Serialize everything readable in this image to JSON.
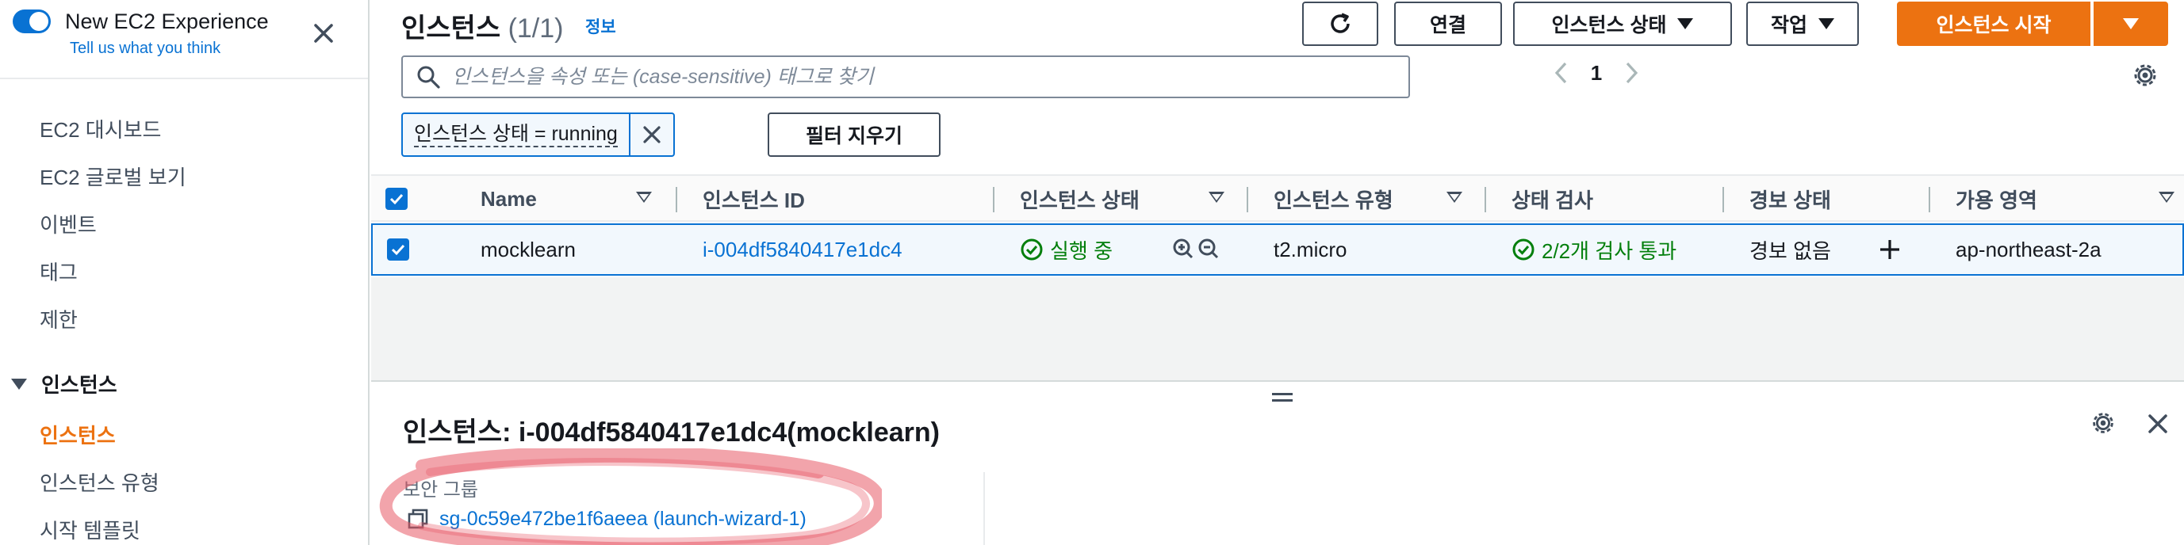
{
  "experience": {
    "title": "New EC2 Experience",
    "subtitle": "Tell us what you think",
    "toggle_on": true
  },
  "sidebar": {
    "items": [
      {
        "label": "EC2 대시보드"
      },
      {
        "label": "EC2 글로벌 보기"
      },
      {
        "label": "이벤트"
      },
      {
        "label": "태그"
      },
      {
        "label": "제한"
      }
    ],
    "section": {
      "label": "인스턴스",
      "expanded": true
    },
    "sub_items": [
      {
        "label": "인스턴스",
        "active": true
      },
      {
        "label": "인스턴스 유형"
      },
      {
        "label": "시작 템플릿"
      }
    ]
  },
  "header": {
    "title": "인스턴스",
    "count": "(1/1)",
    "info": "정보",
    "buttons": {
      "connect": "연결",
      "instance_state": "인스턴스 상태",
      "actions": "작업",
      "launch": "인스턴스 시작"
    }
  },
  "search": {
    "placeholder": "인스턴스을 속성 또는 (case-sensitive) 태그로 찾기",
    "value": ""
  },
  "pagination": {
    "page": "1"
  },
  "filter": {
    "chip": "인스턴스 상태 = running",
    "clear": "필터 지우기"
  },
  "table": {
    "columns": [
      "Name",
      "인스턴스 ID",
      "인스턴스 상태",
      "인스턴스 유형",
      "상태 검사",
      "경보 상태",
      "가용 영역"
    ],
    "rows": [
      {
        "name": "mocklearn",
        "instance_id": "i-004df5840417e1dc4",
        "state": "실행 중",
        "type": "t2.micro",
        "status_check": "2/2개 검사 통과",
        "alarm": "경보 없음",
        "az": "ap-northeast-2a",
        "selected": true
      }
    ]
  },
  "detail": {
    "title": "인스턴스: i-004df5840417e1dc4(mocklearn)",
    "security_label": "보안 그룹",
    "security_value": "sg-0c59e472be1f6aeea (launch-wizard-1)"
  },
  "colors": {
    "accent": "#0972d3",
    "primary": "#ec7211",
    "success": "#037f0c",
    "highlight": "#e85a66"
  }
}
